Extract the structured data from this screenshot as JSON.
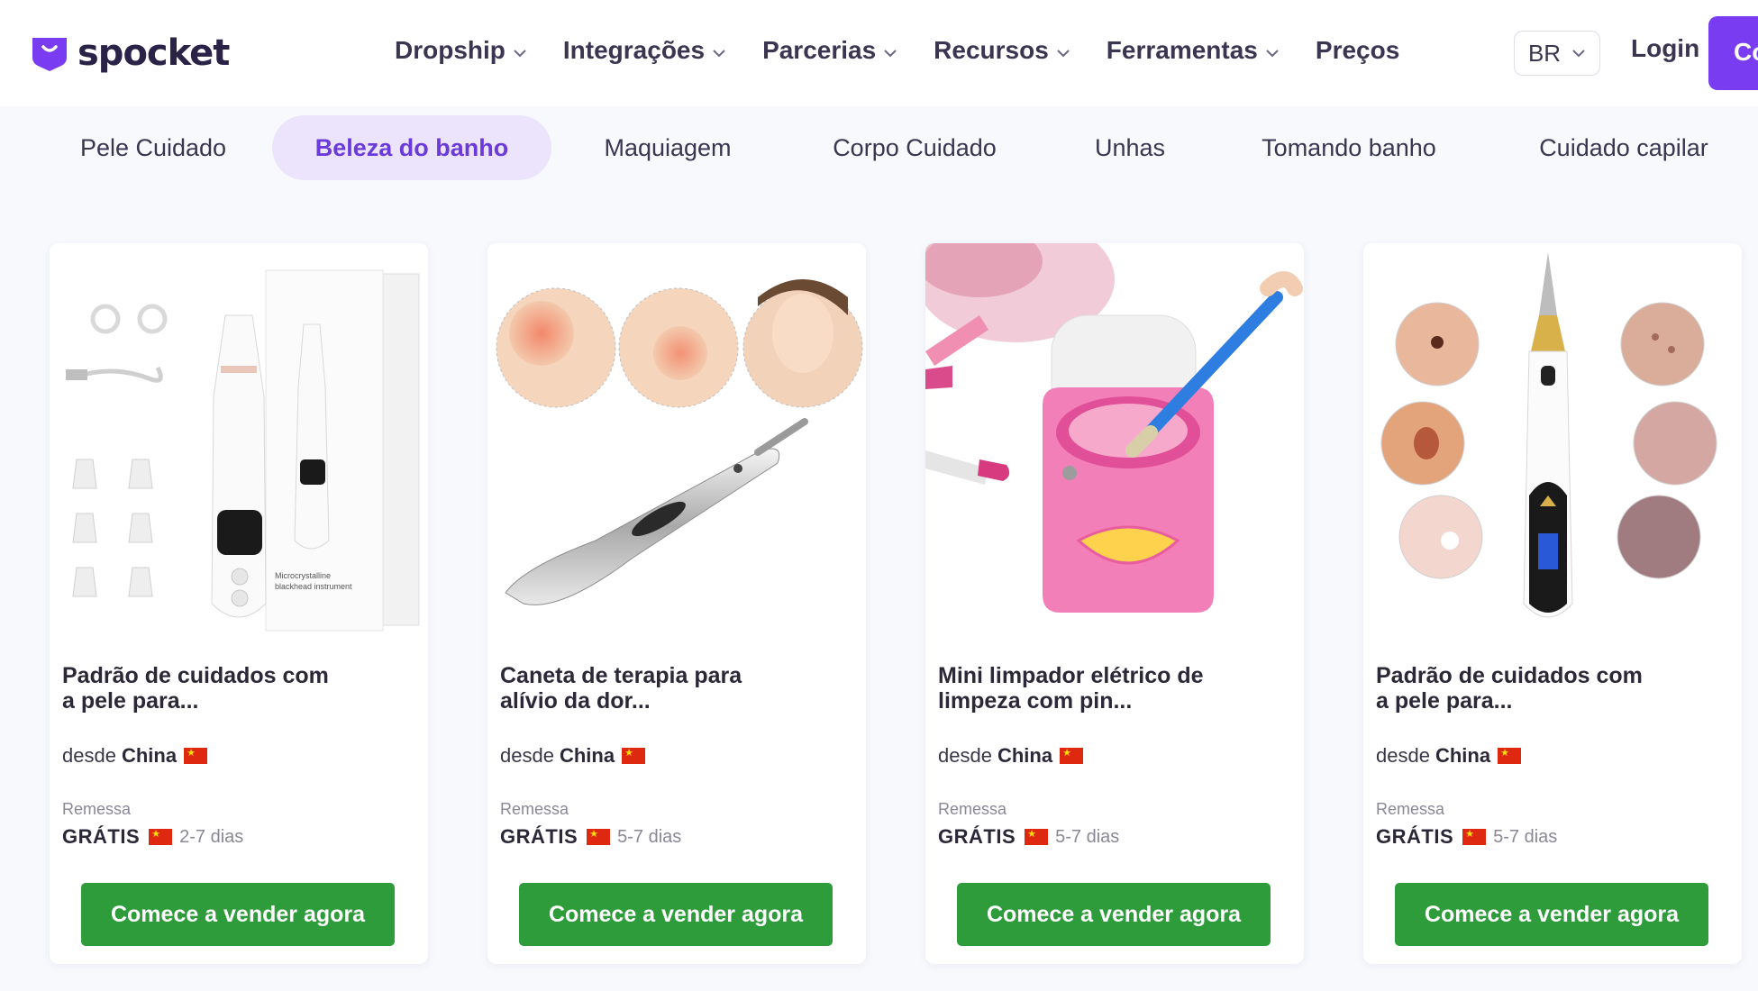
{
  "brand": {
    "name": "spocket"
  },
  "nav": {
    "items": [
      {
        "label": "Dropship",
        "has_menu": true
      },
      {
        "label": "Integrações",
        "has_menu": true
      },
      {
        "label": "Parcerias",
        "has_menu": true
      },
      {
        "label": "Recursos",
        "has_menu": true
      },
      {
        "label": "Ferramentas",
        "has_menu": true
      },
      {
        "label": "Preços",
        "has_menu": false
      }
    ],
    "language": "BR",
    "login": "Login",
    "cta_partial": "Co"
  },
  "tabs": {
    "items": [
      "Pele Cuidado",
      "Beleza do banho",
      "Maquiagem",
      "Corpo Cuidado",
      "Unhas",
      "Tomando banho",
      "Cuidado capilar"
    ],
    "active": "Beleza do banho"
  },
  "products": [
    {
      "title": "Padrão de cuidados com a pele para...",
      "origin_prefix": "desde",
      "origin": "China",
      "shipping_label": "Remessa",
      "shipping_price": "GRÁTIS",
      "shipping_time": "2-7 dias",
      "button": "Comece a vender agora",
      "image_icon": "blackhead-vacuum-kit"
    },
    {
      "title": "Caneta de terapia para alívio da dor...",
      "origin_prefix": "desde",
      "origin": "China",
      "shipping_label": "Remessa",
      "shipping_price": "GRÁTIS",
      "shipping_time": "5-7 dias",
      "button": "Comece a vender agora",
      "image_icon": "therapy-pen"
    },
    {
      "title": "Mini limpador elétrico de limpeza com pin...",
      "origin_prefix": "desde",
      "origin": "China",
      "shipping_label": "Remessa",
      "shipping_price": "GRÁTIS",
      "shipping_time": "5-7 dias",
      "button": "Comece a vender agora",
      "image_icon": "mini-brush-washer"
    },
    {
      "title": "Padrão de cuidados com a pele para...",
      "origin_prefix": "desde",
      "origin": "China",
      "shipping_label": "Remessa",
      "shipping_price": "GRÁTIS",
      "shipping_time": "5-7 dias",
      "button": "Comece a vender agora",
      "image_icon": "mole-removal-pen"
    }
  ],
  "colors": {
    "brand_purple": "#7a3cf0",
    "tab_active_bg": "#ece4fc",
    "tab_active_text": "#6a3bd9",
    "button_green": "#2f9c3c",
    "page_bg": "#f7f9fd"
  }
}
